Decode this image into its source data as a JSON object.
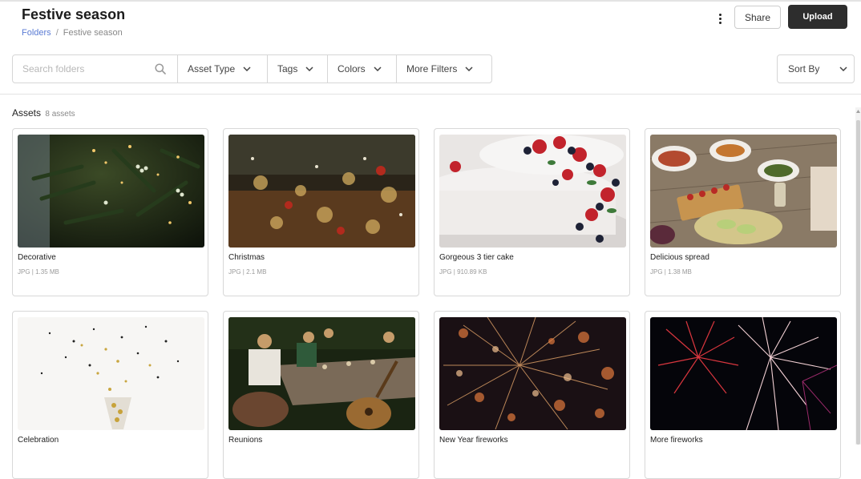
{
  "header": {
    "title": "Festive season",
    "breadcrumb": {
      "root": "Folders",
      "separator": "/",
      "current": "Festive season"
    },
    "share_label": "Share",
    "upload_label": "Upload"
  },
  "filters": {
    "search_placeholder": "Search folders",
    "buttons": [
      "Asset Type",
      "Tags",
      "Colors",
      "More Filters"
    ],
    "sort_label": "Sort By"
  },
  "assets": {
    "label": "Assets",
    "count_label": "8 assets",
    "items": [
      {
        "name": "Decorative",
        "meta": "JPG | 1.35 MB",
        "thumb": "mistletoe-photo"
      },
      {
        "name": "Christmas",
        "meta": "JPG | 2.1 MB",
        "thumb": "christmas-decor-photo"
      },
      {
        "name": "Gorgeous 3 tier cake",
        "meta": "JPG | 910.89 KB",
        "thumb": "cake-photo"
      },
      {
        "name": "Delicious spread",
        "meta": "JPG | 1.38 MB",
        "thumb": "food-spread-photo"
      },
      {
        "name": "Celebration",
        "meta": "",
        "thumb": "glitter-champagne-photo"
      },
      {
        "name": "Reunions",
        "meta": "",
        "thumb": "dinner-party-photo"
      },
      {
        "name": "New Year fireworks",
        "meta": "",
        "thumb": "fireworks-bokeh-photo"
      },
      {
        "name": "More fireworks",
        "meta": "",
        "thumb": "fireworks-night-photo"
      }
    ]
  },
  "colors": {
    "upload_bg": "#2d2d2d",
    "link": "#5a7bd4",
    "border": "#d6d6d6"
  }
}
